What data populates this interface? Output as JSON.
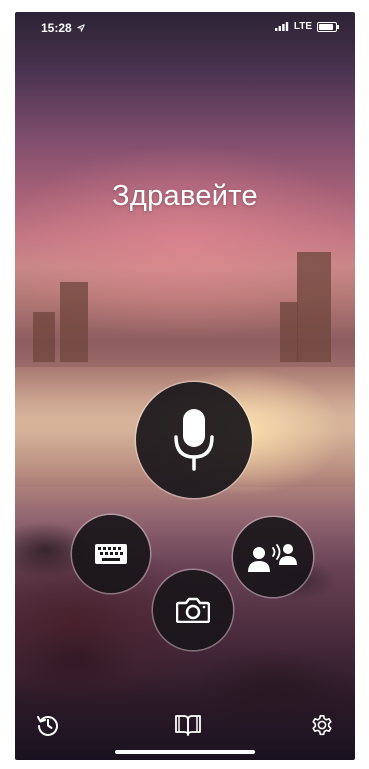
{
  "status_bar": {
    "time": "15:28",
    "location_icon": "location-arrow-icon",
    "network": "LTE",
    "signal_icon": "signal-bars-icon",
    "battery_icon": "battery-icon"
  },
  "main": {
    "greeting": "Здравейте"
  },
  "actions": {
    "voice_icon": "microphone-icon",
    "keyboard_icon": "keyboard-icon",
    "camera_icon": "camera-icon",
    "conversation_icon": "conversation-icon"
  },
  "bottom_bar": {
    "history_icon": "history-icon",
    "phrasebook_icon": "book-icon",
    "settings_icon": "gear-icon"
  },
  "colors": {
    "button_bg": "#19161a",
    "icon": "#ffffff"
  }
}
